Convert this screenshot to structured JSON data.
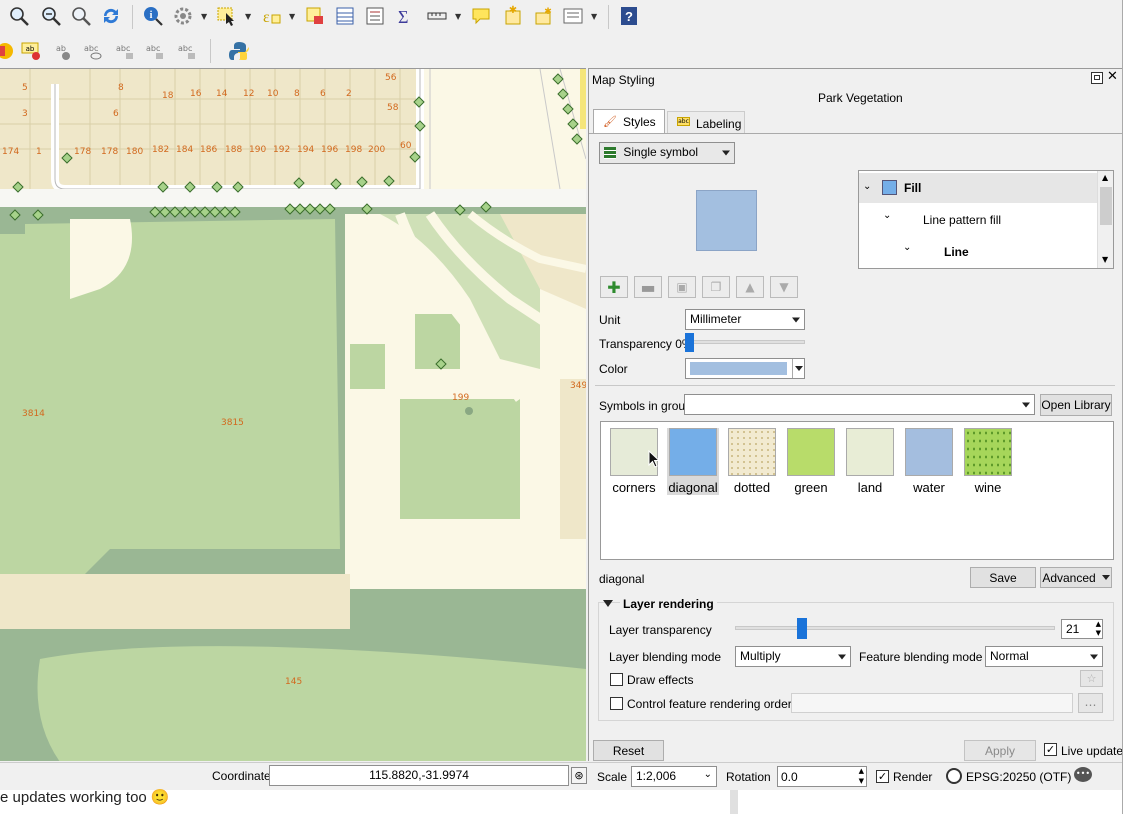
{
  "panel": {
    "title": "Map Styling",
    "layer_name": "Park Vegetation",
    "tabs": [
      {
        "label": "Styles"
      },
      {
        "label": "Labeling"
      }
    ],
    "renderer": "Single symbol",
    "preview_color": "#a3bfe0",
    "tree": [
      {
        "label": "Fill"
      },
      {
        "label": "Line pattern fill"
      },
      {
        "label": "Line"
      }
    ],
    "unit_label": "Unit",
    "unit_value": "Millimeter",
    "transparency_label": "Transparency 0%",
    "color_label": "Color",
    "color_value": "#a3bfe0",
    "symbols_group_label": "Symbols in group",
    "open_library": "Open Library",
    "symbols": [
      {
        "label": "corners",
        "color": "#e6ebd8"
      },
      {
        "label": "diagonal",
        "color": "#74aee8"
      },
      {
        "label": "dotted",
        "color": "#f2ead0"
      },
      {
        "label": "green",
        "color": "#b8dc6a"
      },
      {
        "label": "land",
        "color": "#e8edd6"
      },
      {
        "label": "water",
        "color": "#a4bedf"
      },
      {
        "label": "wine",
        "color": "#a6d65a"
      }
    ],
    "selected_symbol": "diagonal",
    "save": "Save",
    "advanced": "Advanced",
    "layer_rendering": {
      "title": "Layer rendering",
      "transparency_label": "Layer transparency",
      "transparency_value": "21",
      "transparency_fraction": 0.21,
      "blend_label": "Layer blending mode",
      "blend_value": "Multiply",
      "feature_blend_label": "Feature blending mode",
      "feature_blend_value": "Normal",
      "draw_effects": "Draw effects",
      "control_order": "Control feature rendering order"
    },
    "reset": "Reset",
    "apply": "Apply",
    "live_update": "Live update"
  },
  "statusbar": {
    "coordinate_label": "Coordinate",
    "coordinate_value": "115.8820,-31.9974",
    "scale_label": "Scale",
    "scale_value": "1:2,006",
    "rotation_label": "Rotation",
    "rotation_value": "0.0",
    "render_label": "Render",
    "crs": "EPSG:20250 (OTF)"
  },
  "below": {
    "text": "e updates working too 🙂"
  },
  "map": {
    "labels": [
      "5",
      "8",
      "18",
      "16",
      "14",
      "12",
      "10",
      "8",
      "6",
      "2",
      "3",
      "6",
      "56",
      "58",
      "174",
      "1",
      "178",
      "178",
      "180",
      "182",
      "184",
      "186",
      "188",
      "190",
      "192",
      "194",
      "196",
      "198",
      "200",
      "60",
      "3814",
      "3815",
      "199",
      "349",
      "145"
    ]
  },
  "icons": {
    "toolbar1": [
      "zoom-in-icon",
      "zoom-out-icon",
      "zoom-layer-icon",
      "refresh-icon",
      "identify-icon",
      "settings-icon",
      "select-icon",
      "deselect-icon",
      "select-location-icon",
      "attribute-table-icon",
      "field-calc-icon",
      "statistics-icon",
      "measure-icon",
      "annotation-icon",
      "bookmark-icon",
      "new-bookmark-icon",
      "tips-icon",
      "help-icon"
    ],
    "toolbar2": [
      "label-icon",
      "label-pin-icon",
      "label-show-icon",
      "label-move-icon",
      "label-rotate-icon",
      "label-edit-icon",
      "label-change-icon",
      "python-icon"
    ]
  }
}
